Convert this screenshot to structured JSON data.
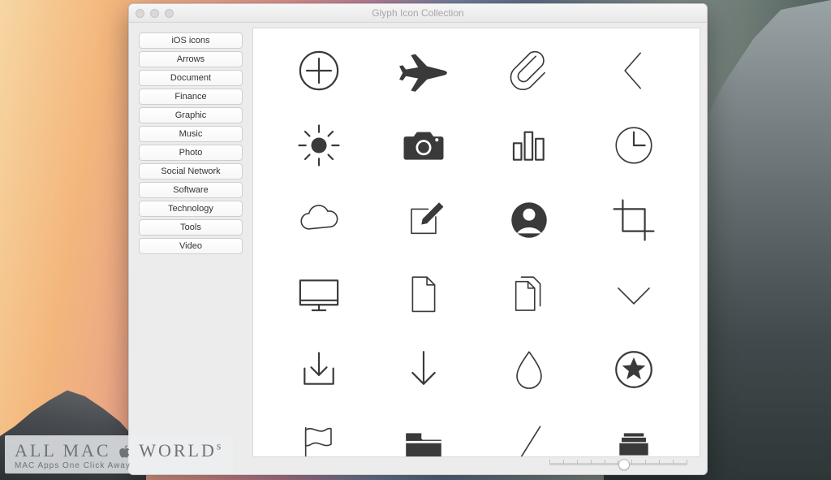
{
  "window": {
    "title": "Glyph Icon Collection"
  },
  "sidebar": {
    "items": [
      {
        "label": "iOS icons"
      },
      {
        "label": "Arrows"
      },
      {
        "label": "Document"
      },
      {
        "label": "Finance"
      },
      {
        "label": "Graphic"
      },
      {
        "label": "Music"
      },
      {
        "label": "Photo"
      },
      {
        "label": "Social Network"
      },
      {
        "label": "Software"
      },
      {
        "label": "Technology"
      },
      {
        "label": "Tools"
      },
      {
        "label": "Video"
      }
    ]
  },
  "grid": {
    "columns": 4,
    "icons": [
      {
        "name": "plus-circle"
      },
      {
        "name": "airplane"
      },
      {
        "name": "paperclip"
      },
      {
        "name": "chevron-left"
      },
      {
        "name": "brightness-sun"
      },
      {
        "name": "camera"
      },
      {
        "name": "bar-chart"
      },
      {
        "name": "clock"
      },
      {
        "name": "cloud"
      },
      {
        "name": "compose"
      },
      {
        "name": "contact"
      },
      {
        "name": "crop"
      },
      {
        "name": "monitor"
      },
      {
        "name": "document"
      },
      {
        "name": "documents"
      },
      {
        "name": "chevron-down"
      },
      {
        "name": "download"
      },
      {
        "name": "arrow-down"
      },
      {
        "name": "drop"
      },
      {
        "name": "star-circle"
      },
      {
        "name": "flag"
      },
      {
        "name": "folder"
      },
      {
        "name": "slash"
      },
      {
        "name": "stack"
      }
    ]
  },
  "slider": {
    "value": 54,
    "min": 0,
    "max": 100,
    "ticks": 11
  },
  "watermark": {
    "line1a": "ALL MAC",
    "line1b": "WORLD",
    "suffix": "s",
    "line2": "MAC Apps One Click Away"
  }
}
